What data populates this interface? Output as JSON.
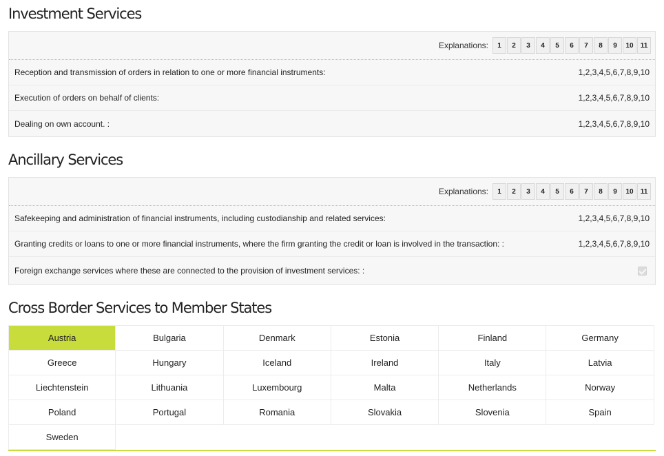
{
  "investment": {
    "title": "Investment Services",
    "explanations_label": "Explanations:",
    "explanations": [
      "1",
      "2",
      "3",
      "4",
      "5",
      "6",
      "7",
      "8",
      "9",
      "10",
      "11"
    ],
    "rows": [
      {
        "label": "Reception and transmission of orders in relation to one or more financial instruments:",
        "value": "1,2,3,4,5,6,7,8,9,10"
      },
      {
        "label": "Execution of orders on behalf of clients:",
        "value": "1,2,3,4,5,6,7,8,9,10"
      },
      {
        "label": "Dealing on own account. :",
        "value": "1,2,3,4,5,6,7,8,9,10"
      }
    ]
  },
  "ancillary": {
    "title": "Ancillary Services",
    "explanations_label": "Explanations:",
    "explanations": [
      "1",
      "2",
      "3",
      "4",
      "5",
      "6",
      "7",
      "8",
      "9",
      "10",
      "11"
    ],
    "rows": [
      {
        "label": "Safekeeping and administration of financial instruments, including custodianship and related services:",
        "value": "1,2,3,4,5,6,7,8,9,10"
      },
      {
        "label": "Granting credits or loans to one or more financial instruments, where the firm granting the credit or loan is involved in the transaction: :",
        "value": "1,2,3,4,5,6,7,8,9,10"
      },
      {
        "label": "Foreign exchange services where these are connected to the provision of investment services: :",
        "checked": true
      }
    ]
  },
  "cross_border": {
    "title": "Cross Border Services to Member States",
    "selected": "Austria",
    "countries": [
      "Austria",
      "Bulgaria",
      "Denmark",
      "Estonia",
      "Finland",
      "Germany",
      "Greece",
      "Hungary",
      "Iceland",
      "Ireland",
      "Italy",
      "Latvia",
      "Liechtenstein",
      "Lithuania",
      "Luxembourg",
      "Malta",
      "Netherlands",
      "Norway",
      "Poland",
      "Portugal",
      "Romania",
      "Slovakia",
      "Slovenia",
      "Spain",
      "Sweden"
    ]
  },
  "colors": {
    "accent": "#c8dc3c"
  }
}
